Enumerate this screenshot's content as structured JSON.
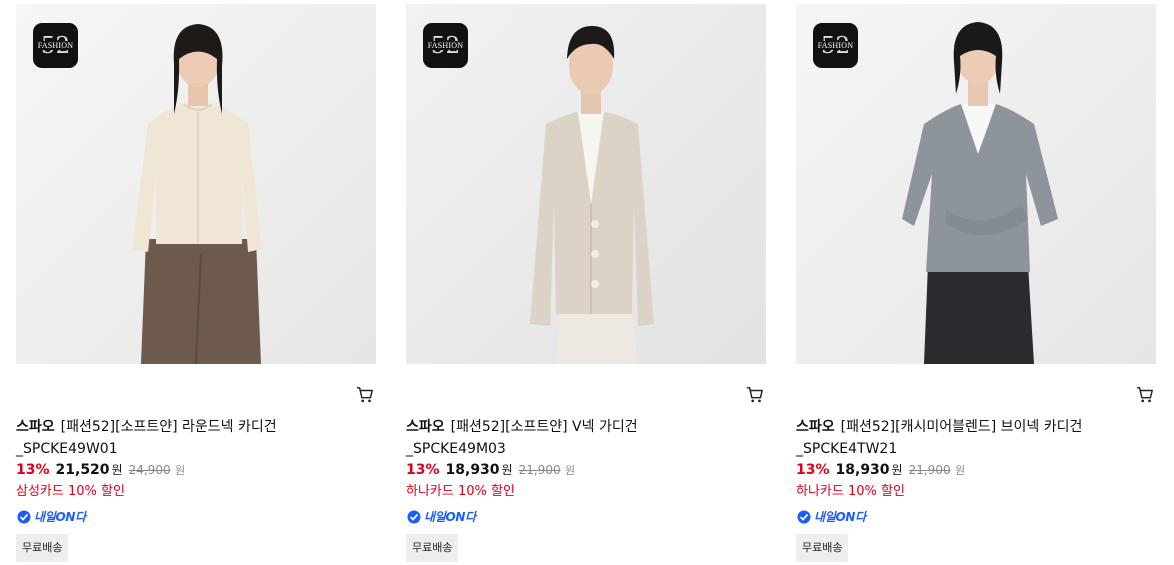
{
  "products": [
    {
      "brand": "스파오",
      "name": "[패션52][소프트얀] 라운드넥 카디건_SPCKE49W01",
      "discount": "13%",
      "price": "21,520",
      "won": "원",
      "original_price": "24,900",
      "card_discount": "삼성카드 10% 할인",
      "delivery_badge": "내일ON다",
      "shipping": "무료배송",
      "badge_text": "FASHION",
      "badge_number": "52",
      "colors": {
        "garment": "#efe6d6",
        "pants": "#6d5a4d",
        "bg": "#f2f2f1"
      }
    },
    {
      "brand": "스파오",
      "name": "[패션52][소프트얀] V넥 가디건_SPCKE49M03",
      "discount": "13%",
      "price": "18,930",
      "won": "원",
      "original_price": "21,900",
      "card_discount": "하나카드 10% 할인",
      "delivery_badge": "내일ON다",
      "shipping": "무료배송",
      "badge_text": "FASHION",
      "badge_number": "52",
      "colors": {
        "garment": "#dbd3c6",
        "pants": "#ede9e1",
        "bg": "#ececec"
      }
    },
    {
      "brand": "스파오",
      "name": "[패션52][캐시미어블렌드] 브이넥 카디건_SPCKE4TW21",
      "discount": "13%",
      "price": "18,930",
      "won": "원",
      "original_price": "21,900",
      "card_discount": "하나카드 10% 할인",
      "delivery_badge": "내일ON다",
      "shipping": "무료배송",
      "badge_text": "FASHION",
      "badge_number": "52",
      "colors": {
        "garment": "#8d949c",
        "pants": "#2a2b2f",
        "bg": "#efefef"
      }
    }
  ]
}
